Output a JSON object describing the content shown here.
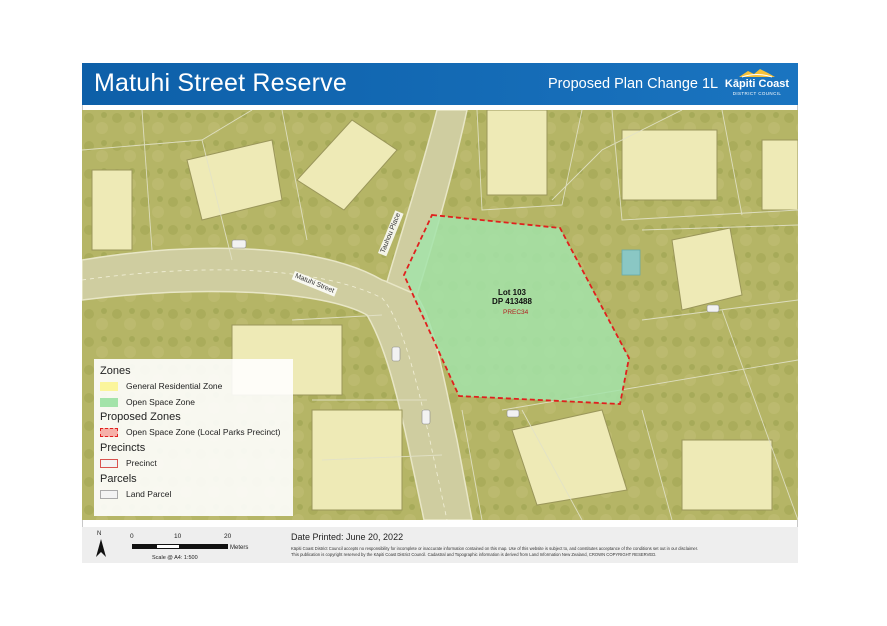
{
  "header": {
    "title": "Matuhi Street Reserve",
    "subtitle": "Proposed Plan Change 1L",
    "logo_name": "Kāpiti Coast",
    "logo_sub": "DISTRICT COUNCIL"
  },
  "map": {
    "street_labels": [
      "Matuhi Street",
      "Tauhou Place"
    ],
    "lot_lines": [
      "Lot 103",
      "DP 413488"
    ],
    "precinct_label": "PREC34"
  },
  "legend": {
    "groups": [
      {
        "title": "Zones",
        "items": [
          {
            "label": "General Residential Zone",
            "swatch": "#fbf59b"
          },
          {
            "label": "Open Space Zone",
            "swatch": "#a3e3a9"
          }
        ]
      },
      {
        "title": "Proposed Zones",
        "items": [
          {
            "label": "Open Space Zone (Local Parks Precinct)",
            "swatch": "dashed-red"
          }
        ]
      },
      {
        "title": "Precincts",
        "items": [
          {
            "label": "Precinct",
            "swatch": "outline-red"
          }
        ]
      },
      {
        "title": "Parcels",
        "items": [
          {
            "label": "Land Parcel",
            "swatch": "outline-grey"
          }
        ]
      }
    ]
  },
  "footer": {
    "north": "N",
    "scale_ticks": [
      "0",
      "10",
      "20"
    ],
    "scale_unit": "Meters",
    "scale_note": "Scale @ A4: 1:500",
    "date_printed": "Date Printed: June 20, 2022",
    "disclaimer_1": "Kāpiti Coast District Council accepts no responsibility for incomplete or inaccurate information contained on this map. Use of this website is subject to, and constitutes acceptance of the conditions set out in our disclaimer.",
    "disclaimer_2": "This publication is copyright reserved by the Kāpiti Coast District Council. Cadastral and Topographic information is derived from Land Information New Zealand, CROWN COPYRIGHT RESERVED."
  },
  "colors": {
    "header_blue": "#1266b0",
    "residential_zone": "#fbf59b",
    "open_space_zone": "#a3e3a9",
    "precinct_outline": "#e0201e"
  }
}
